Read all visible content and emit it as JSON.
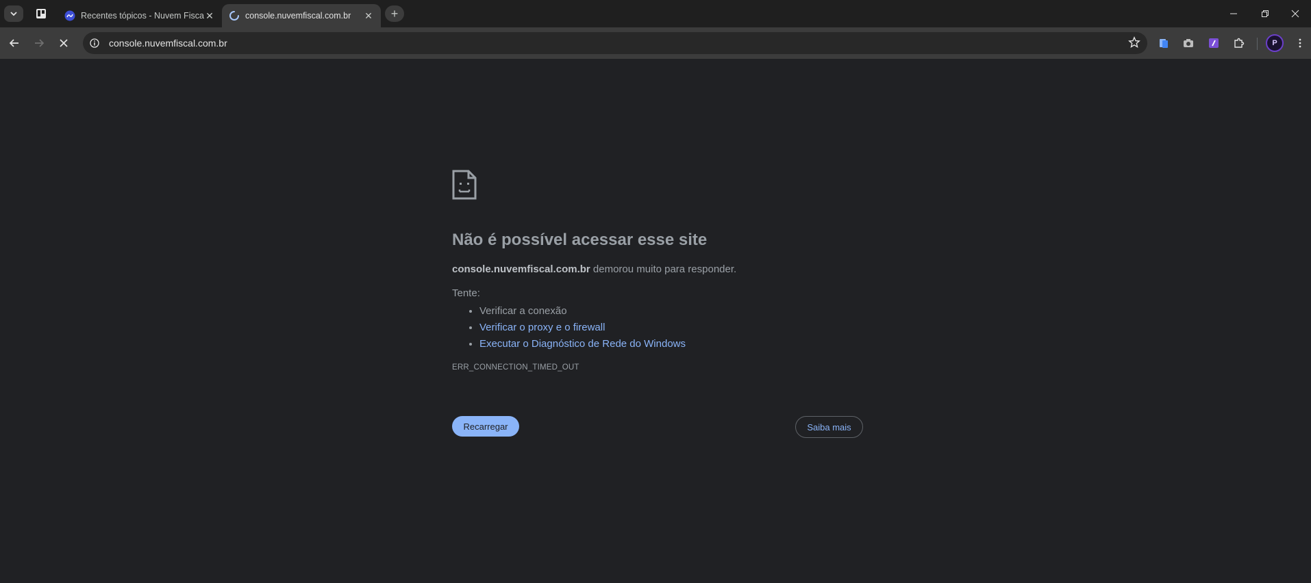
{
  "tabs": [
    {
      "title": "Recentes tópicos - Nuvem Fiscal",
      "active": false
    },
    {
      "title": "console.nuvemfiscal.com.br",
      "active": true,
      "loading": true
    }
  ],
  "tab_close_label": "✕",
  "new_tab_label": "+",
  "omnibox": {
    "url": "console.nuvemfiscal.com.br"
  },
  "profile": {
    "initial": "P"
  },
  "error": {
    "title": "Não é possível acessar esse site",
    "host": "console.nuvemfiscal.com.br",
    "summary_rest": " demorou muito para responder.",
    "try_label": "Tente:",
    "suggestions": [
      {
        "text": "Verificar a conexão",
        "link": false
      },
      {
        "text": "Verificar o proxy e o firewall",
        "link": true
      },
      {
        "text": "Executar o Diagnóstico de Rede do Windows",
        "link": true
      }
    ],
    "code": "ERR_CONNECTION_TIMED_OUT",
    "reload_label": "Recarregar",
    "learn_more_label": "Saiba mais"
  },
  "colors": {
    "page_bg": "#202124",
    "link": "#8ab4f8",
    "reload_button_bg": "#8ab4f8",
    "toolbar_bg": "#3c3c3c",
    "tabstrip_bg": "#1f1f1f"
  }
}
